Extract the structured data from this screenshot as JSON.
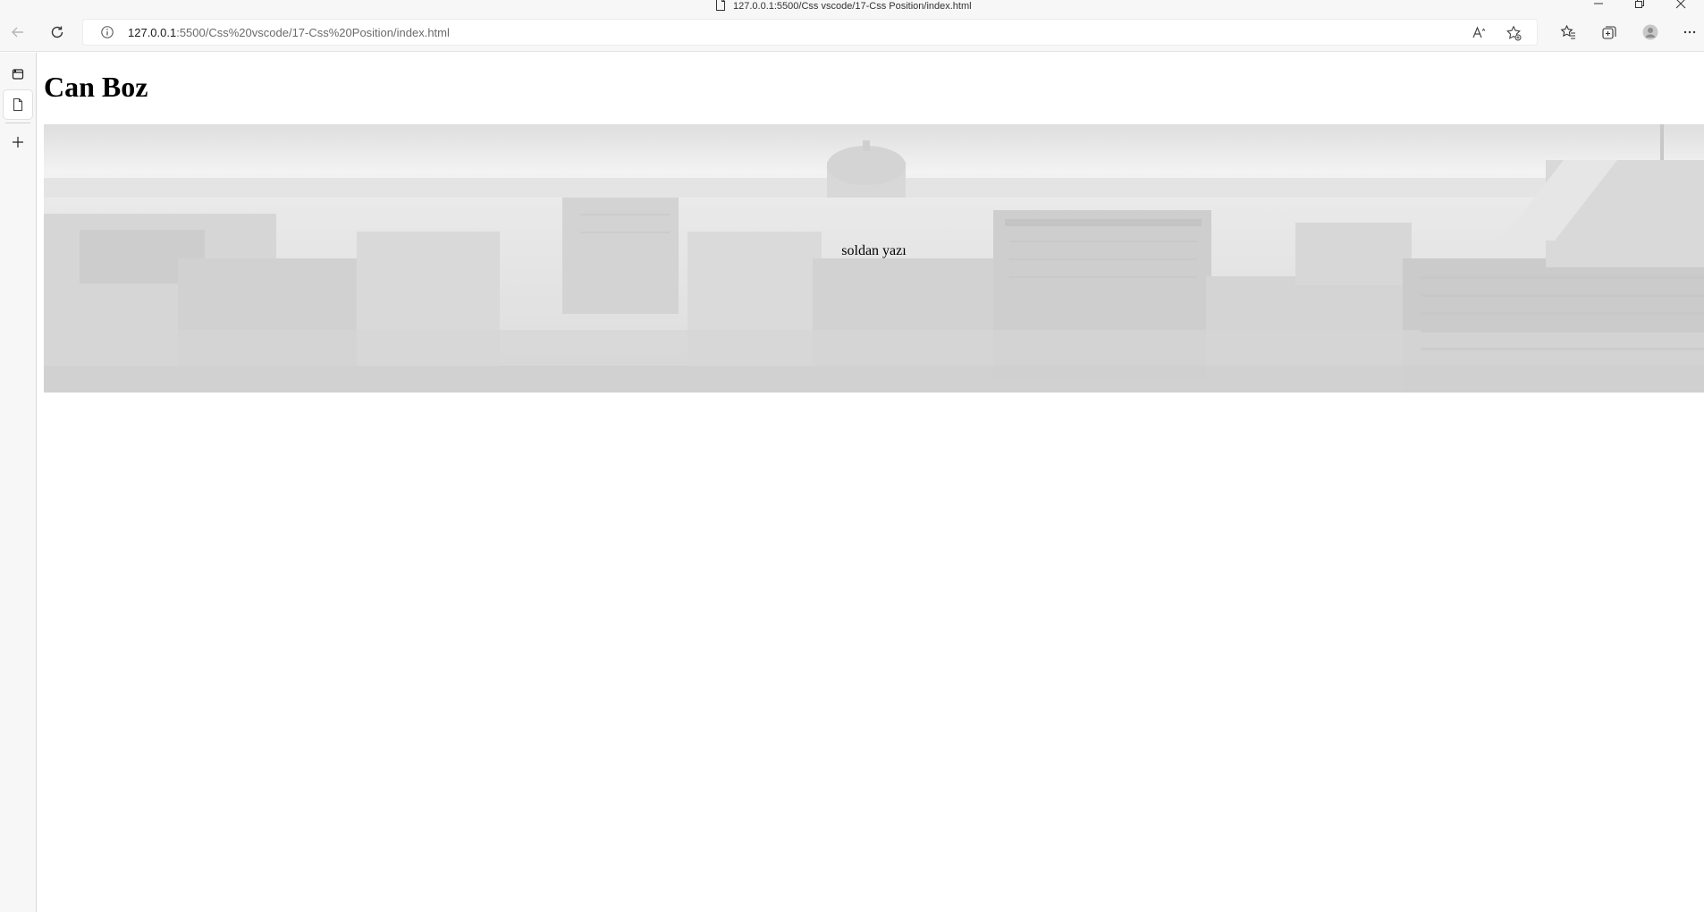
{
  "window": {
    "title": "127.0.0.1:5500/Css vscode/17-Css Position/index.html"
  },
  "toolbar": {
    "url_host": "127.0.0.1",
    "url_rest": ":5500/Css%20vscode/17-Css%20Position/index.html"
  },
  "icons": {
    "back": "back-arrow-icon",
    "refresh": "refresh-icon",
    "info": "info-icon",
    "read_aloud": "read-aloud-icon",
    "add_favorite": "add-favorite-icon",
    "favorites": "favorites-icon",
    "collections": "collections-icon",
    "profile": "profile-icon",
    "more": "more-icon",
    "tab_actions": "tab-actions-icon",
    "page_tab": "page-tab-icon",
    "new_tab": "new-tab-icon"
  },
  "page": {
    "heading": "Can Boz",
    "hero_caption": "soldan yazı"
  },
  "colors": {
    "chrome_bg": "#f7f7f7",
    "page_bg": "#ffffff",
    "hero_tint": "#e6e6e6"
  }
}
